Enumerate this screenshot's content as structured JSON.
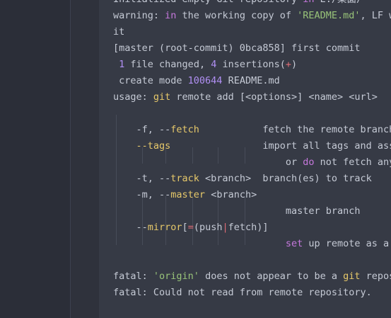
{
  "terminal": {
    "lines": [
      {
        "segments": [
          {
            "t": "Initialized empty Git repository ",
            "c": ""
          },
          {
            "t": "in",
            "c": "kw"
          },
          {
            "t": " E:/桌面/",
            "c": ""
          }
        ]
      },
      {
        "segments": [
          {
            "t": "warning: ",
            "c": ""
          },
          {
            "t": "in",
            "c": "kw"
          },
          {
            "t": " the working copy of ",
            "c": ""
          },
          {
            "t": "'README.md'",
            "c": "str"
          },
          {
            "t": ", LF will be replaced by CRLF",
            "c": ""
          }
        ]
      },
      {
        "segments": [
          {
            "t": "it",
            "c": ""
          }
        ]
      },
      {
        "segments": [
          {
            "t": "[master (root-commit) 0bca858] first commit",
            "c": ""
          }
        ]
      },
      {
        "segments": [
          {
            "t": " ",
            "c": ""
          },
          {
            "t": "1",
            "c": "num"
          },
          {
            "t": " file changed, ",
            "c": ""
          },
          {
            "t": "4",
            "c": "num"
          },
          {
            "t": " insertions(",
            "c": ""
          },
          {
            "t": "+",
            "c": "plus"
          },
          {
            "t": ")",
            "c": ""
          }
        ]
      },
      {
        "segments": [
          {
            "t": " create mode ",
            "c": ""
          },
          {
            "t": "100644",
            "c": "num"
          },
          {
            "t": " README.md",
            "c": ""
          }
        ]
      },
      {
        "segments": [
          {
            "t": "usage: ",
            "c": ""
          },
          {
            "t": "git",
            "c": "yel"
          },
          {
            "t": " remote add [<options>] <name> <url>",
            "c": ""
          }
        ]
      },
      {
        "segments": [
          {
            "t": "",
            "c": ""
          }
        ]
      },
      {
        "segments": [
          {
            "t": "    -f, --",
            "c": ""
          },
          {
            "t": "fetch",
            "c": "yel"
          },
          {
            "t": "           fetch the remote branches",
            "c": ""
          }
        ]
      },
      {
        "segments": [
          {
            "t": "    --tags",
            "c": "yel"
          },
          {
            "t": "                import all tags and associated objects when fetching",
            "c": ""
          }
        ]
      },
      {
        "segments": [
          {
            "t": "                              or ",
            "c": ""
          },
          {
            "t": "do",
            "c": "kw"
          },
          {
            "t": " not fetch any tag at all (--no-tags)",
            "c": ""
          }
        ]
      },
      {
        "segments": [
          {
            "t": "    -t, --",
            "c": ""
          },
          {
            "t": "track",
            "c": "yel"
          },
          {
            "t": " <branch>  branch(es) to track",
            "c": ""
          }
        ]
      },
      {
        "segments": [
          {
            "t": "    -m, --",
            "c": ""
          },
          {
            "t": "master",
            "c": "yel"
          },
          {
            "t": " <branch>",
            "c": ""
          }
        ]
      },
      {
        "segments": [
          {
            "t": "                              master branch",
            "c": ""
          }
        ]
      },
      {
        "segments": [
          {
            "t": "    --",
            "c": ""
          },
          {
            "t": "mirror",
            "c": "yel"
          },
          {
            "t": "[",
            "c": ""
          },
          {
            "t": "=",
            "c": "plus"
          },
          {
            "t": "(push",
            "c": ""
          },
          {
            "t": "|",
            "c": "pipe"
          },
          {
            "t": "fetch)]",
            "c": ""
          }
        ]
      },
      {
        "segments": [
          {
            "t": "                              ",
            "c": ""
          },
          {
            "t": "set",
            "c": "kw"
          },
          {
            "t": " up remote as a mirror to push to or fetch from",
            "c": ""
          }
        ]
      },
      {
        "segments": [
          {
            "t": "",
            "c": ""
          }
        ]
      },
      {
        "segments": [
          {
            "t": "fatal: ",
            "c": ""
          },
          {
            "t": "'origin'",
            "c": "str"
          },
          {
            "t": " does not appear to be a ",
            "c": ""
          },
          {
            "t": "git",
            "c": "yel"
          },
          {
            "t": " repository",
            "c": ""
          }
        ]
      },
      {
        "segments": [
          {
            "t": "fatal: Could not read from remote repository.",
            "c": ""
          }
        ]
      }
    ]
  }
}
